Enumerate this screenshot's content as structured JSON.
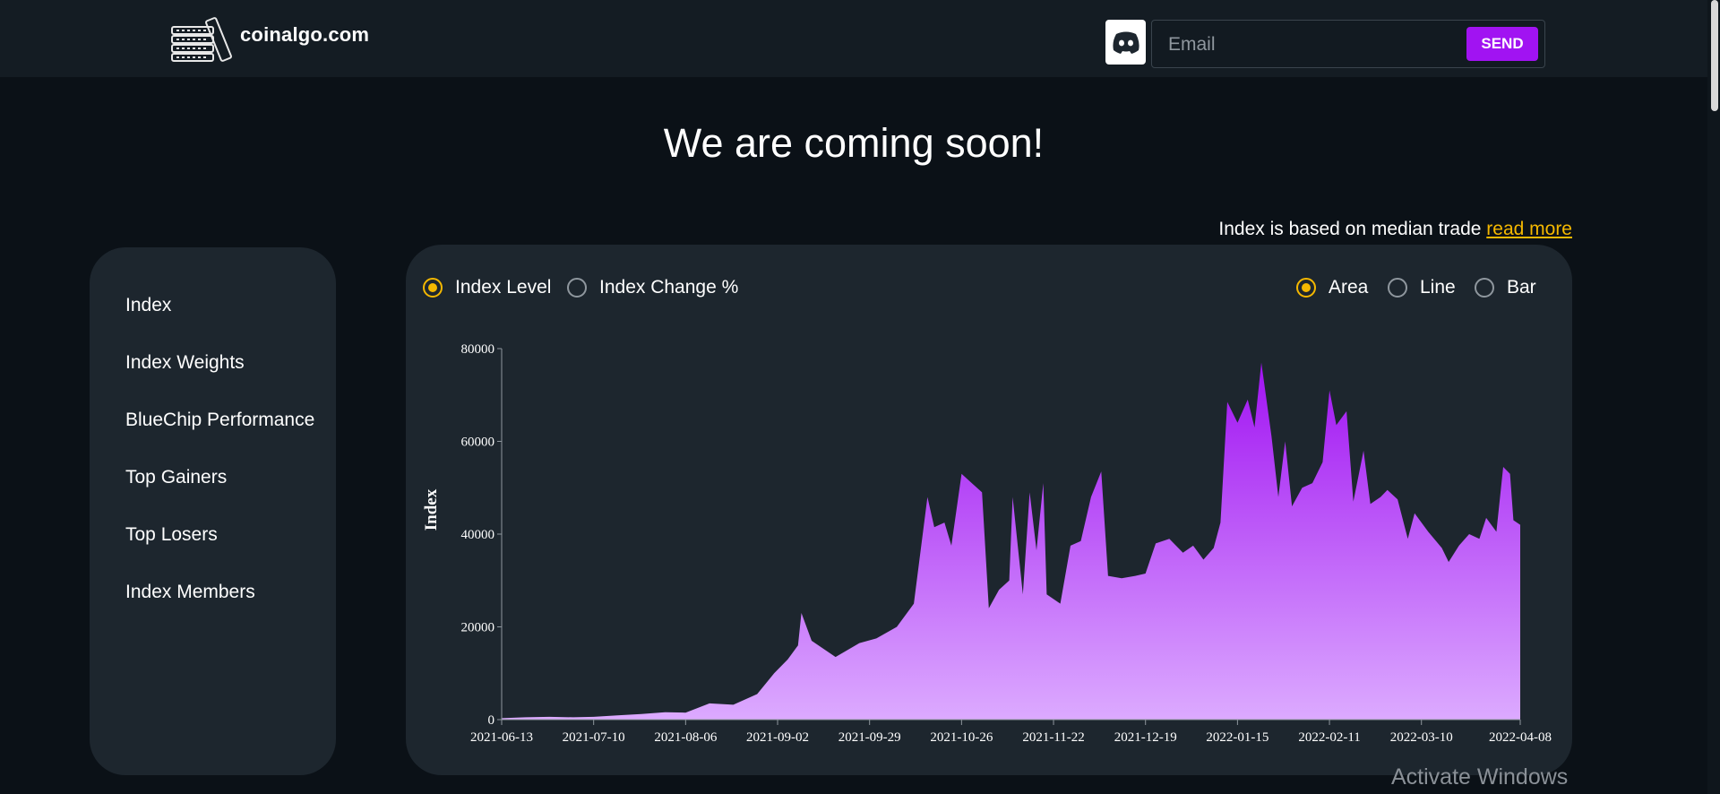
{
  "header": {
    "brand_name": "coinalgo.com",
    "logo_icon": "coin-stack-logo",
    "discord_icon": "discord-icon",
    "email_placeholder": "Email",
    "send_label": "SEND",
    "accent_color": "#a113f2"
  },
  "headline": "We are coming soon!",
  "index_note": {
    "text": "Index is based on median trade ",
    "link": "read more",
    "link_color": "#f5b800"
  },
  "sidebar": {
    "items": [
      {
        "label": "Index"
      },
      {
        "label": "Index Weights"
      },
      {
        "label": "BlueChip Performance"
      },
      {
        "label": "Top Gainers"
      },
      {
        "label": "Top Losers"
      },
      {
        "label": "Index Members"
      }
    ]
  },
  "chart_controls": {
    "metric_options": [
      {
        "label": "Index Level",
        "selected": true
      },
      {
        "label": "Index Change %",
        "selected": false
      }
    ],
    "type_options": [
      {
        "label": "Area",
        "selected": true
      },
      {
        "label": "Line",
        "selected": false
      },
      {
        "label": "Bar",
        "selected": false
      }
    ],
    "selected_color": "#f5b800"
  },
  "chart_data": {
    "type": "area",
    "ylabel": "Index",
    "xlabel": "",
    "ylim": [
      0,
      80000
    ],
    "yticks": [
      0,
      20000,
      40000,
      60000,
      80000
    ],
    "xticks": [
      "2021-06-13",
      "2021-07-10",
      "2021-08-06",
      "2021-09-02",
      "2021-09-29",
      "2021-10-26",
      "2021-11-22",
      "2021-12-19",
      "2022-01-15",
      "2022-02-11",
      "2022-03-10",
      "2022-04-08"
    ],
    "series": [
      {
        "color_top": "#a113f2",
        "color_bottom": "#dcaaff",
        "points": [
          [
            "2021-06-13",
            300
          ],
          [
            "2021-06-20",
            500
          ],
          [
            "2021-06-27",
            600
          ],
          [
            "2021-07-04",
            500
          ],
          [
            "2021-07-10",
            600
          ],
          [
            "2021-07-17",
            900
          ],
          [
            "2021-07-24",
            1200
          ],
          [
            "2021-07-31",
            1600
          ],
          [
            "2021-08-06",
            1500
          ],
          [
            "2021-08-13",
            3500
          ],
          [
            "2021-08-20",
            3200
          ],
          [
            "2021-08-27",
            5500
          ],
          [
            "2021-09-01",
            10000
          ],
          [
            "2021-09-05",
            13000
          ],
          [
            "2021-09-08",
            16000
          ],
          [
            "2021-09-09",
            23000
          ],
          [
            "2021-09-12",
            17000
          ],
          [
            "2021-09-19",
            13500
          ],
          [
            "2021-09-26",
            16500
          ],
          [
            "2021-10-01",
            17500
          ],
          [
            "2021-10-07",
            20000
          ],
          [
            "2021-10-12",
            25000
          ],
          [
            "2021-10-16",
            48000
          ],
          [
            "2021-10-18",
            41500
          ],
          [
            "2021-10-21",
            42500
          ],
          [
            "2021-10-23",
            37500
          ],
          [
            "2021-10-26",
            53000
          ],
          [
            "2021-10-29",
            51000
          ],
          [
            "2021-11-01",
            49000
          ],
          [
            "2021-11-03",
            24000
          ],
          [
            "2021-11-06",
            28000
          ],
          [
            "2021-11-09",
            30000
          ],
          [
            "2021-11-10",
            48000
          ],
          [
            "2021-11-13",
            27000
          ],
          [
            "2021-11-15",
            49000
          ],
          [
            "2021-11-17",
            36500
          ],
          [
            "2021-11-19",
            51000
          ],
          [
            "2021-11-20",
            27000
          ],
          [
            "2021-11-24",
            25000
          ],
          [
            "2021-11-27",
            37500
          ],
          [
            "2021-11-30",
            38500
          ],
          [
            "2021-12-03",
            48000
          ],
          [
            "2021-12-06",
            53500
          ],
          [
            "2021-12-08",
            31000
          ],
          [
            "2021-12-12",
            30500
          ],
          [
            "2021-12-16",
            31000
          ],
          [
            "2021-12-19",
            31500
          ],
          [
            "2021-12-22",
            38000
          ],
          [
            "2021-12-26",
            39000
          ],
          [
            "2021-12-30",
            36000
          ],
          [
            "2022-01-02",
            37500
          ],
          [
            "2022-01-05",
            34500
          ],
          [
            "2022-01-08",
            37000
          ],
          [
            "2022-01-10",
            42500
          ],
          [
            "2022-01-12",
            68500
          ],
          [
            "2022-01-15",
            64000
          ],
          [
            "2022-01-18",
            69000
          ],
          [
            "2022-01-20",
            63000
          ],
          [
            "2022-01-22",
            77000
          ],
          [
            "2022-01-25",
            61000
          ],
          [
            "2022-01-27",
            48000
          ],
          [
            "2022-01-29",
            60000
          ],
          [
            "2022-01-31",
            46000
          ],
          [
            "2022-02-03",
            50000
          ],
          [
            "2022-02-06",
            51000
          ],
          [
            "2022-02-09",
            55500
          ],
          [
            "2022-02-11",
            71000
          ],
          [
            "2022-02-13",
            63500
          ],
          [
            "2022-02-16",
            66500
          ],
          [
            "2022-02-18",
            47000
          ],
          [
            "2022-02-21",
            58000
          ],
          [
            "2022-02-23",
            46500
          ],
          [
            "2022-02-26",
            48000
          ],
          [
            "2022-02-28",
            49500
          ],
          [
            "2022-03-03",
            47500
          ],
          [
            "2022-03-06",
            39000
          ],
          [
            "2022-03-08",
            44500
          ],
          [
            "2022-03-12",
            40500
          ],
          [
            "2022-03-16",
            37000
          ],
          [
            "2022-03-18",
            34000
          ],
          [
            "2022-03-21",
            37500
          ],
          [
            "2022-03-24",
            40000
          ],
          [
            "2022-03-27",
            39000
          ],
          [
            "2022-03-29",
            43500
          ],
          [
            "2022-04-01",
            40500
          ],
          [
            "2022-04-03",
            54500
          ],
          [
            "2022-04-05",
            53000
          ],
          [
            "2022-04-06",
            43000
          ],
          [
            "2022-04-08",
            42000
          ]
        ]
      }
    ],
    "grid": false,
    "legend": "none"
  },
  "watermark": "Activate Windows"
}
